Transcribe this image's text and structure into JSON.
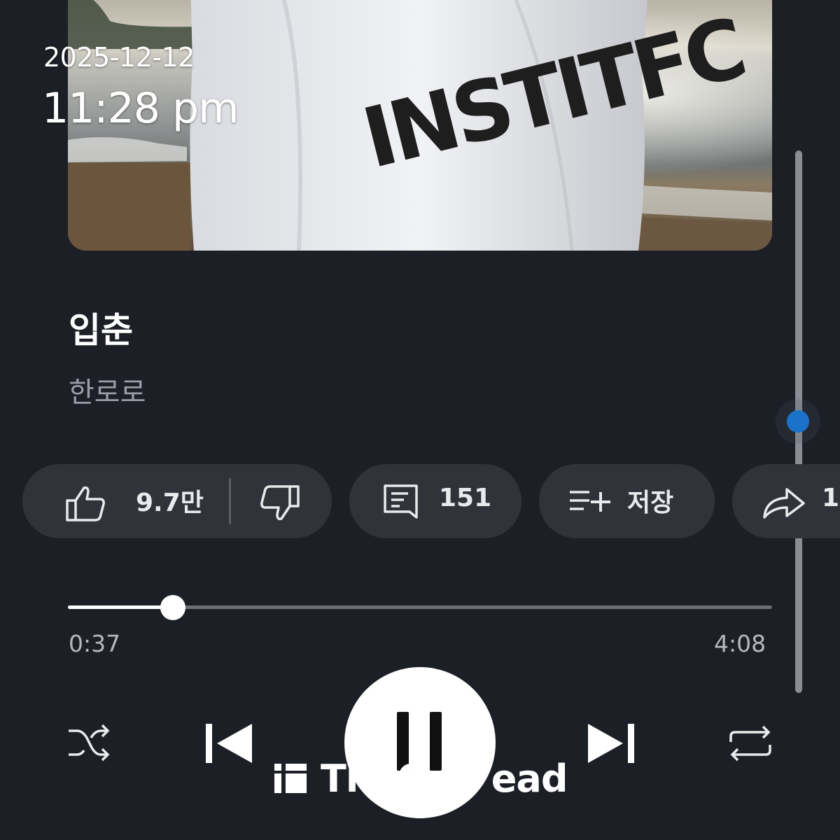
{
  "status": {
    "date": "2025-12-12",
    "time": "11:28 pm"
  },
  "album_art": {
    "shirt_text": "INSTITFC"
  },
  "song": {
    "title": "입춘",
    "artist": "한로로"
  },
  "actions": {
    "like_count": "9.7만",
    "comment_count": "151",
    "save_label": "저장",
    "share_label": "1"
  },
  "progress": {
    "current": "0:37",
    "total": "4:08",
    "fraction": 0.149
  },
  "controls": {
    "shuffle_icon": "shuffle-icon",
    "previous_icon": "skip-previous-icon",
    "pause_icon": "pause-icon",
    "next_icon": "skip-next-icon",
    "repeat_icon": "repeat-icon"
  },
  "watermark": {
    "text": "TheQoo ead"
  },
  "colors": {
    "background": "#1c1f25",
    "chip": "#30333a",
    "accent_blue": "#1a73c8",
    "artist_gray": "#9a9ea6"
  }
}
